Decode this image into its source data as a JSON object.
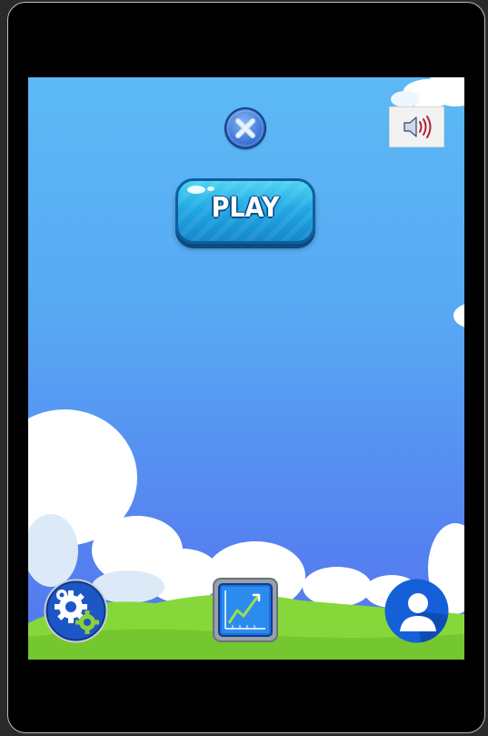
{
  "game": {
    "play_label": "PLAY",
    "sound_state": "on"
  },
  "icons": {
    "close": "close-icon",
    "sound": "speaker-volume-icon",
    "settings": "gears-icon",
    "stats": "line-chart-icon",
    "profile": "user-silhouette-icon"
  },
  "colors": {
    "sky_top": "#5cb9f5",
    "sky_bottom": "#5578ee",
    "grass": "#7dd334",
    "play_button": "#22a8e4",
    "profile_button": "#1560d8"
  }
}
